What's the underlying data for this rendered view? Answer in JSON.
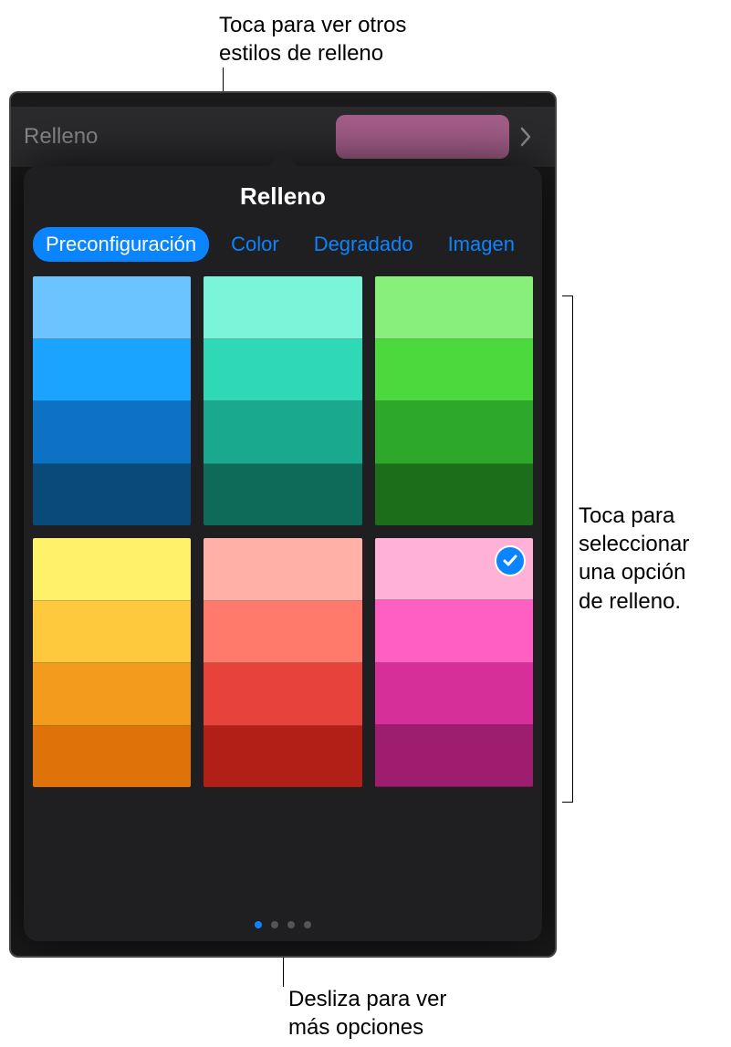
{
  "annotations": {
    "top": "Toca para ver otros\nestilos de relleno",
    "right": "Toca para\nseleccionar\nuna opción\nde relleno.",
    "bottom": "Desliza para ver\nmás opciones"
  },
  "bgRow": {
    "label": "Relleno",
    "swatch_color": "#a55f8a"
  },
  "popover": {
    "title": "Relleno",
    "tabs": [
      "Preconfiguración",
      "Color",
      "Degradado",
      "Imagen"
    ],
    "active_tab": 0,
    "pages": 4,
    "active_page": 0,
    "selected_tile": 5,
    "tiles": [
      {
        "name": "blue",
        "bands": [
          "#6bc4ff",
          "#1aa3ff",
          "#0d72c4",
          "#0a4a7a"
        ]
      },
      {
        "name": "teal",
        "bands": [
          "#7af5d9",
          "#2fd9b8",
          "#18a98e",
          "#0e6b5a"
        ]
      },
      {
        "name": "green",
        "bands": [
          "#88f07a",
          "#4bd93e",
          "#2ea82a",
          "#1c6e1a"
        ]
      },
      {
        "name": "yellow",
        "bands": [
          "#fff169",
          "#ffc93e",
          "#f39b1c",
          "#e0720a"
        ]
      },
      {
        "name": "red",
        "bands": [
          "#ffb1a8",
          "#ff7a6a",
          "#e8433a",
          "#b11f17"
        ]
      },
      {
        "name": "pink",
        "bands": [
          "#ffb1d8",
          "#ff5fc0",
          "#d62f99",
          "#9e1d6e"
        ]
      }
    ]
  }
}
